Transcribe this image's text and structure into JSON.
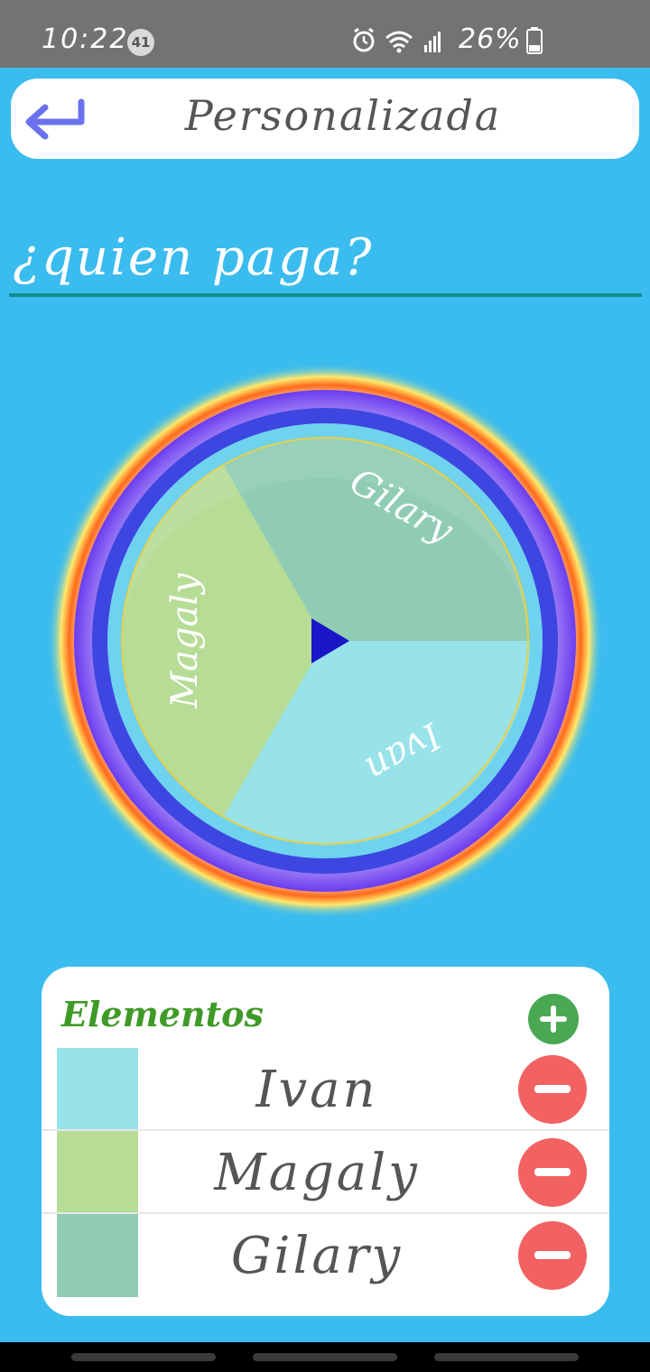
{
  "status_bar": {
    "time": "10:22",
    "notification_count": "41",
    "battery": "26%",
    "icons": [
      "alarm-icon",
      "wifi-icon",
      "signal-icon",
      "battery-icon"
    ]
  },
  "header": {
    "title": "Personalizada",
    "back_icon": "back-arrow-icon",
    "accent_color": "#6b72f0"
  },
  "question": {
    "value": "¿quien paga?",
    "underline_color": "#108f8f"
  },
  "wheel": {
    "segments": [
      {
        "label": "Gilary",
        "color": "#90ccb4"
      },
      {
        "label": "Ivan",
        "color": "#98e2ea"
      },
      {
        "label": "Magaly",
        "color": "#b7dc96"
      }
    ],
    "pointer_color": "#1a16c8"
  },
  "elements": {
    "title": "Elementos",
    "add_icon": "plus-icon",
    "remove_icon": "minus-icon",
    "items": [
      {
        "name": "Ivan",
        "color": "#98e2ea"
      },
      {
        "name": "Magaly",
        "color": "#b7dc96"
      },
      {
        "name": "Gilary",
        "color": "#90ccb4"
      }
    ]
  }
}
